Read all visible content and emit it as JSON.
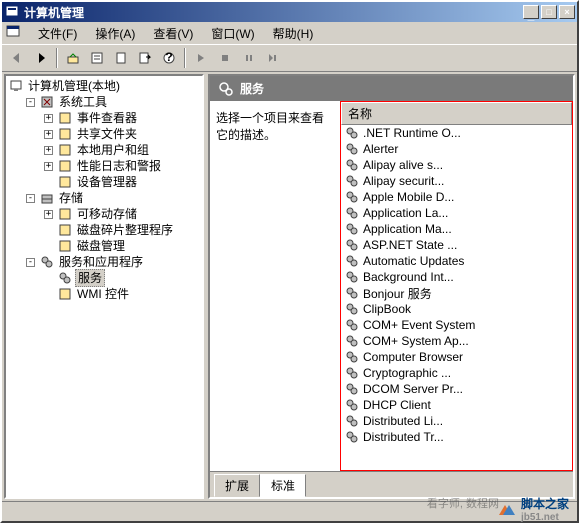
{
  "window": {
    "title": "计算机管理"
  },
  "titlebar_buttons": {
    "minimize": "_",
    "maximize": "□",
    "close": "×"
  },
  "menubar": [
    {
      "label": "文件(F)",
      "key": "file"
    },
    {
      "label": "操作(A)",
      "key": "action"
    },
    {
      "label": "查看(V)",
      "key": "view"
    },
    {
      "label": "窗口(W)",
      "key": "window"
    },
    {
      "label": "帮助(H)",
      "key": "help"
    }
  ],
  "tree": {
    "root": {
      "label": "计算机管理(本地)",
      "expanded": true
    },
    "system_tools": {
      "label": "系统工具",
      "expanded": true,
      "children": [
        {
          "label": "事件查看器",
          "icon": "event",
          "expandable": true
        },
        {
          "label": "共享文件夹",
          "icon": "share",
          "expandable": true
        },
        {
          "label": "本地用户和组",
          "icon": "users",
          "expandable": true
        },
        {
          "label": "性能日志和警报",
          "icon": "perf",
          "expandable": true
        },
        {
          "label": "设备管理器",
          "icon": "device",
          "expandable": false
        }
      ]
    },
    "storage": {
      "label": "存储",
      "expanded": true,
      "children": [
        {
          "label": "可移动存储",
          "icon": "removable",
          "expandable": true
        },
        {
          "label": "磁盘碎片整理程序",
          "icon": "defrag",
          "expandable": false
        },
        {
          "label": "磁盘管理",
          "icon": "diskmgmt",
          "expandable": false
        }
      ]
    },
    "services_apps": {
      "label": "服务和应用程序",
      "expanded": true,
      "children": [
        {
          "label": "服务",
          "icon": "services",
          "selected": true,
          "expandable": false
        },
        {
          "label": "WMI 控件",
          "icon": "wmi",
          "expandable": false
        }
      ]
    }
  },
  "right": {
    "title": "服务",
    "description": "选择一个项目来查看它的描述。",
    "column_header": "名称",
    "services": [
      ".NET Runtime O...",
      "Alerter",
      "Alipay alive s...",
      "Alipay securit...",
      "Apple Mobile D...",
      "Application La...",
      "Application Ma...",
      "ASP.NET State ...",
      "Automatic Updates",
      "Background Int...",
      "Bonjour 服务",
      "ClipBook",
      "COM+ Event System",
      "COM+ System Ap...",
      "Computer Browser",
      "Cryptographic ...",
      "DCOM Server Pr...",
      "DHCP Client",
      "Distributed Li...",
      "Distributed Tr..."
    ]
  },
  "tabs": {
    "extended": "扩展",
    "standard": "标准"
  },
  "watermark": {
    "line1": "看字师, 数程网",
    "line2": "脚本之家",
    "url": "jb51.net"
  }
}
